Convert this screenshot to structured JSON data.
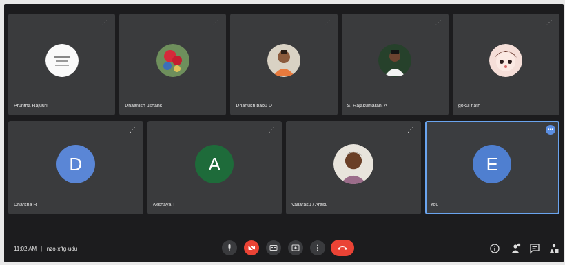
{
  "participants_top": [
    {
      "name": "Pruntha Rajuuri",
      "avatar": "photo-white-logo"
    },
    {
      "name": "Dhaanish ushans",
      "avatar": "photo-flowers"
    },
    {
      "name": "Dhanush babu D",
      "avatar": "photo-man"
    },
    {
      "name": "S. Rajakumaran. A",
      "avatar": "photo-man-white-shirt"
    },
    {
      "name": "gokul nath",
      "avatar": "photo-doll"
    }
  ],
  "participants_bottom": [
    {
      "name": "Dharsha R",
      "avatar_letter": "D",
      "avatar_color": "#5a86d6"
    },
    {
      "name": "Akshaya T",
      "avatar_letter": "A",
      "avatar_color": "#1e6b3a"
    },
    {
      "name": "Vallarasu / Arasu",
      "avatar": "photo-young-man"
    },
    {
      "name": "You",
      "avatar_letter": "E",
      "avatar_color": "#4f7fd0"
    }
  ],
  "meeting": {
    "time": "11:02 AM",
    "separator": "|",
    "code": "nzo-xftg-udu"
  },
  "colors": {
    "end_call": "#ea4335",
    "selected_outline": "#6aa4ee"
  }
}
